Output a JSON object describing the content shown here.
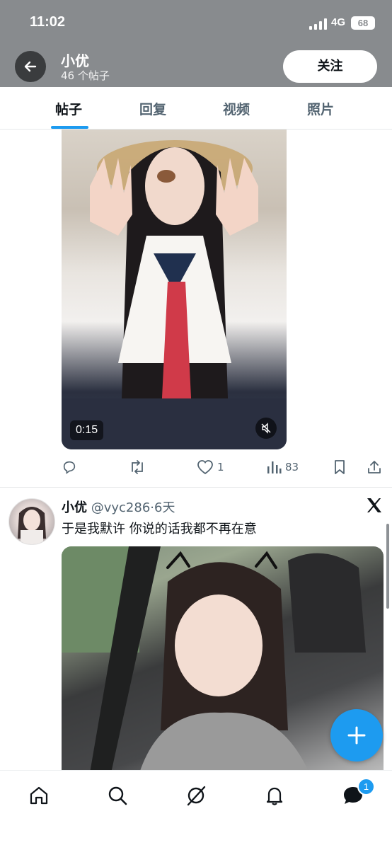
{
  "status_bar": {
    "time": "11:02",
    "network": "4G",
    "battery": "68"
  },
  "header": {
    "name": "小优",
    "post_count": "46 个帖子",
    "follow_label": "关注"
  },
  "tabs": [
    {
      "label": "帖子",
      "active": true
    },
    {
      "label": "回复",
      "active": false
    },
    {
      "label": "视频",
      "active": false
    },
    {
      "label": "照片",
      "active": false
    }
  ],
  "post1": {
    "video_duration": "0:15",
    "actions": {
      "like_count": "1",
      "view_count": "83"
    }
  },
  "post2": {
    "name": "小优",
    "handle": "@vyc286",
    "separator": "·",
    "time": "6天",
    "text": "于是我默许 你说的话我都不再在意"
  },
  "bottom_nav": {
    "items": [
      "home-icon",
      "search-icon",
      "grok-icon",
      "notifications-icon",
      "messages-icon"
    ],
    "messages_badge": "1"
  },
  "colors": {
    "accent": "#1d9bf0",
    "header_bg": "#888b8e",
    "secondary_text": "#536471"
  }
}
